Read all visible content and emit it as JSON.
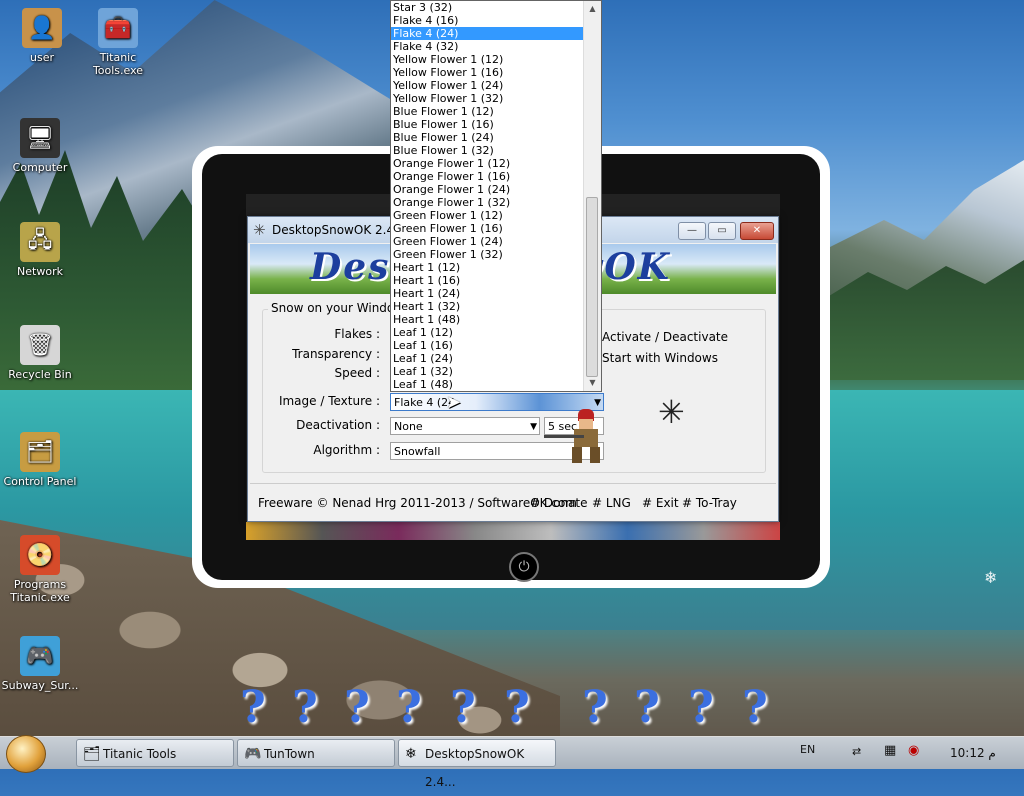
{
  "desktop": {
    "icons": [
      {
        "label": "user",
        "glyph": "👤"
      },
      {
        "label": "Titanic\nTools.exe",
        "glyph": "🧰"
      },
      {
        "label": "Computer",
        "glyph": "🖥"
      },
      {
        "label": "Network",
        "glyph": "🖧"
      },
      {
        "label": "Recycle Bin",
        "glyph": "🗑"
      },
      {
        "label": "Control Panel",
        "glyph": "🗂"
      },
      {
        "label": "Programs\nTitanic.exe",
        "glyph": "📀"
      },
      {
        "label": "Subway_Sur...",
        "glyph": "🎮"
      }
    ]
  },
  "window": {
    "title": "DesktopSnowOK 2.41 (",
    "minimize": "—",
    "maximize": "▭",
    "close": "✕",
    "banner": "DesktopSnowOK",
    "group_label": "Snow on your Windows d",
    "labels": {
      "flakes": "Flakes :",
      "transparency": "Transparency :",
      "speed": "Speed :",
      "image": "Image / Texture :",
      "deactivation": "Deactivation :",
      "algorithm": "Algorithm :"
    },
    "image_value": "Flake 4 (24",
    "deactivation_value": "None",
    "deactivation_extra": "5 sec",
    "algorithm_value": "Snowfall",
    "check_activate": "Activate / Deactivate",
    "check_start": "Start with Windows",
    "footer": {
      "freeware": "Freeware © Nenad Hrg 2011-2013 / SoftwareOK.com",
      "donate": "# Donate",
      "lng": "# LNG",
      "exit": "# Exit",
      "totray": "# To-Tray"
    }
  },
  "dropdown": {
    "items": [
      "Star 3 (32)",
      "Flake 4 (16)",
      "Flake 4 (24)",
      "Flake 4 (32)",
      "Yellow Flower 1 (12)",
      "Yellow Flower 1 (16)",
      "Yellow Flower 1 (24)",
      "Yellow Flower 1 (32)",
      "Blue Flower 1 (12)",
      "Blue Flower 1 (16)",
      "Blue Flower 1 (24)",
      "Blue Flower 1 (32)",
      "Orange Flower 1 (12)",
      "Orange Flower 1 (16)",
      "Orange Flower 1 (24)",
      "Orange Flower 1 (32)",
      "Green Flower 1 (12)",
      "Green Flower 1 (16)",
      "Green Flower 1 (24)",
      "Green Flower 1 (32)",
      "Heart 1 (12)",
      "Heart 1 (16)",
      "Heart 1 (24)",
      "Heart 1 (32)",
      "Heart 1 (48)",
      "Leaf 1 (12)",
      "Leaf 1 (16)",
      "Leaf 1 (24)",
      "Leaf 1 (32)",
      "Leaf 1 (48)"
    ],
    "selected_index": 2
  },
  "taskbar": {
    "tasks": [
      {
        "label": "Titanic Tools",
        "icon": "🗂"
      },
      {
        "label": "TunTown",
        "icon": "🎮"
      },
      {
        "label": "DesktopSnowOK 2.4...",
        "icon": "❄"
      }
    ],
    "lang": "EN",
    "time": "10:12 م"
  },
  "colors": {
    "selection": "#3399ff",
    "banner_text": "#1d3f9e"
  }
}
